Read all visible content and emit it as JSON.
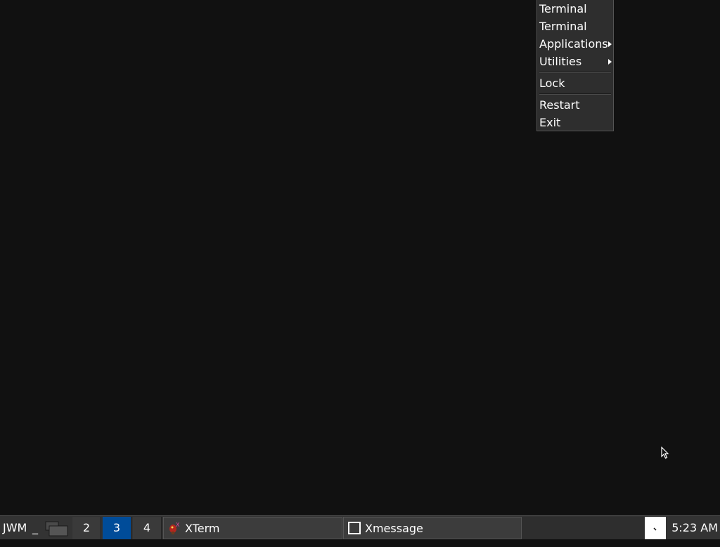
{
  "root_menu": {
    "items": [
      {
        "label": "Terminal"
      },
      {
        "label": "Terminal"
      },
      {
        "label": "Applications",
        "submenu": true
      },
      {
        "label": "Utilities",
        "submenu": true
      },
      {
        "label": "Lock"
      },
      {
        "label": "Restart"
      },
      {
        "label": "Exit"
      }
    ]
  },
  "taskbar": {
    "start_label": "JWM",
    "minimize_label": "_",
    "pager": [
      {
        "label": ""
      },
      {
        "label": "2"
      },
      {
        "label": "3",
        "active": true
      },
      {
        "label": "4"
      }
    ],
    "tasks": [
      {
        "label": "XTerm",
        "icon": "xterm-icon"
      },
      {
        "label": "Xmessage",
        "icon": "window-icon"
      }
    ],
    "clock": "5:23 AM"
  },
  "colors": {
    "desktop": "#111111",
    "taskbar": "#333333",
    "active_desktop": "#004c99",
    "menu_bg": "#2e2e2e"
  }
}
